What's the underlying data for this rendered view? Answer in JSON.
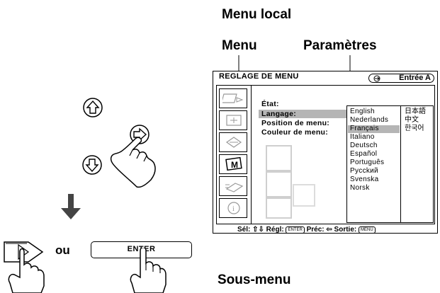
{
  "callouts": {
    "menu_local": "Menu local",
    "menu": "Menu",
    "parametres": "Paramètres",
    "sous_menu": "Sous-menu"
  },
  "osd": {
    "title": "REGLAGE DE MENU",
    "input_indicator": "Entrée A",
    "params": [
      "État:",
      "Langage:",
      "Position de menu:",
      "Couleur de menu:"
    ],
    "languages_col1": [
      "English",
      "Nederlands",
      "Français",
      "Italiano",
      "Deutsch",
      "Español",
      "Português",
      "Pycckий",
      "Svenska",
      "Norsk"
    ],
    "languages_col2": [
      "日本語",
      "中文",
      "한국어"
    ],
    "selected_language": "Français",
    "highlighted_param": "Langage:",
    "footer": {
      "sel": "Sél:",
      "regl": "Régl:",
      "enter_key": "ENTER",
      "prec": "Préc:",
      "sortie": "Sortie:",
      "menu_key": "MENU"
    },
    "icons": [
      "picture-icon",
      "picture-adjust-icon",
      "input-icon",
      "menu-setup-icon",
      "installation-icon",
      "information-icon",
      "blank-icon"
    ]
  },
  "buttons": {
    "or_label": "ou",
    "enter_label": "ENTER"
  }
}
